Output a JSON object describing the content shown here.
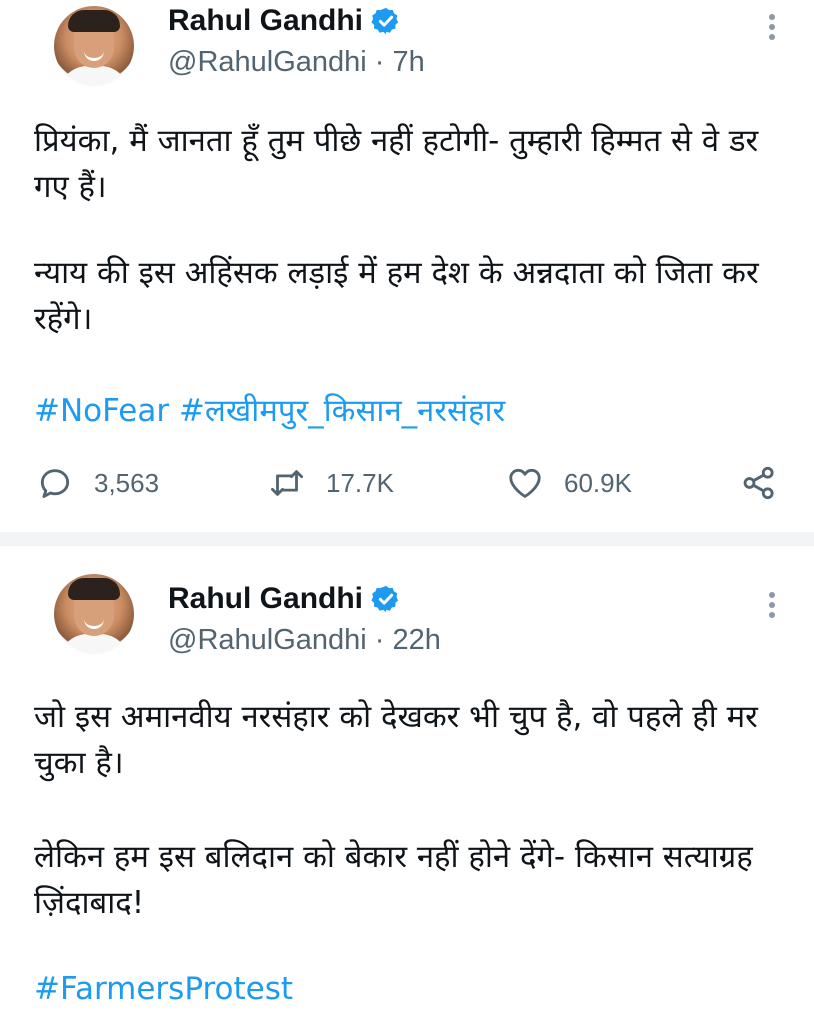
{
  "tweets": [
    {
      "author": {
        "name": "Rahul Gandhi",
        "handle": "@RahulGandhi",
        "time": "· 7h",
        "verified": true
      },
      "paragraphs": [
        "प्रियंका, मैं जानता हूँ तुम पीछे नहीं हटोगी- तुम्हारी हिम्मत से वे डर गए हैं।",
        "न्याय की इस अहिंसक लड़ाई में हम देश के अन्नदाता को जिता कर रहेंगे।"
      ],
      "hashtags": "#NoFear #लखीमपुर_किसान_नरसंहार",
      "stats": {
        "replies": "3,563",
        "retweets": "17.7K",
        "likes": "60.9K"
      },
      "icons": {
        "reply": "speech-bubble-icon",
        "retweet": "retweet-icon",
        "like": "heart-icon",
        "share": "share-icon",
        "more": "vertical-dots-icon",
        "verified": "verified-badge-icon"
      }
    },
    {
      "author": {
        "name": "Rahul Gandhi",
        "handle": "@RahulGandhi",
        "time": "· 22h",
        "verified": true
      },
      "paragraphs": [
        "जो इस अमानवीय नरसंहार को देखकर भी चुप है, वो पहले ही मर चुका है।",
        "लेकिन हम इस बलिदान को बेकार नहीं होने देंगे- किसान सत्याग्रह ज़िंदाबाद!"
      ],
      "hashtags": "#FarmersProtest"
    }
  ],
  "colors": {
    "link": "#1d9bf0",
    "secondary_text": "#536471",
    "divider": "#f2f4f5",
    "verified": "#1d9bf0"
  }
}
